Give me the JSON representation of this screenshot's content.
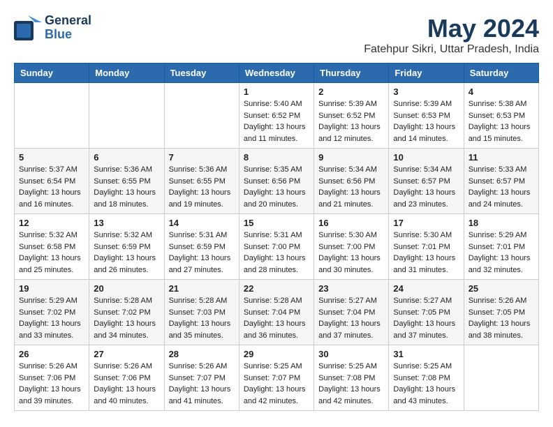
{
  "header": {
    "logo_line1": "General",
    "logo_line2": "Blue",
    "title": "May 2024",
    "subtitle": "Fatehpur Sikri, Uttar Pradesh, India"
  },
  "days_of_week": [
    "Sunday",
    "Monday",
    "Tuesday",
    "Wednesday",
    "Thursday",
    "Friday",
    "Saturday"
  ],
  "weeks": [
    [
      {
        "day": "",
        "sunrise": "",
        "sunset": "",
        "daylight": ""
      },
      {
        "day": "",
        "sunrise": "",
        "sunset": "",
        "daylight": ""
      },
      {
        "day": "",
        "sunrise": "",
        "sunset": "",
        "daylight": ""
      },
      {
        "day": "1",
        "sunrise": "Sunrise: 5:40 AM",
        "sunset": "Sunset: 6:52 PM",
        "daylight": "Daylight: 13 hours and 11 minutes."
      },
      {
        "day": "2",
        "sunrise": "Sunrise: 5:39 AM",
        "sunset": "Sunset: 6:52 PM",
        "daylight": "Daylight: 13 hours and 12 minutes."
      },
      {
        "day": "3",
        "sunrise": "Sunrise: 5:39 AM",
        "sunset": "Sunset: 6:53 PM",
        "daylight": "Daylight: 13 hours and 14 minutes."
      },
      {
        "day": "4",
        "sunrise": "Sunrise: 5:38 AM",
        "sunset": "Sunset: 6:53 PM",
        "daylight": "Daylight: 13 hours and 15 minutes."
      }
    ],
    [
      {
        "day": "5",
        "sunrise": "Sunrise: 5:37 AM",
        "sunset": "Sunset: 6:54 PM",
        "daylight": "Daylight: 13 hours and 16 minutes."
      },
      {
        "day": "6",
        "sunrise": "Sunrise: 5:36 AM",
        "sunset": "Sunset: 6:55 PM",
        "daylight": "Daylight: 13 hours and 18 minutes."
      },
      {
        "day": "7",
        "sunrise": "Sunrise: 5:36 AM",
        "sunset": "Sunset: 6:55 PM",
        "daylight": "Daylight: 13 hours and 19 minutes."
      },
      {
        "day": "8",
        "sunrise": "Sunrise: 5:35 AM",
        "sunset": "Sunset: 6:56 PM",
        "daylight": "Daylight: 13 hours and 20 minutes."
      },
      {
        "day": "9",
        "sunrise": "Sunrise: 5:34 AM",
        "sunset": "Sunset: 6:56 PM",
        "daylight": "Daylight: 13 hours and 21 minutes."
      },
      {
        "day": "10",
        "sunrise": "Sunrise: 5:34 AM",
        "sunset": "Sunset: 6:57 PM",
        "daylight": "Daylight: 13 hours and 23 minutes."
      },
      {
        "day": "11",
        "sunrise": "Sunrise: 5:33 AM",
        "sunset": "Sunset: 6:57 PM",
        "daylight": "Daylight: 13 hours and 24 minutes."
      }
    ],
    [
      {
        "day": "12",
        "sunrise": "Sunrise: 5:32 AM",
        "sunset": "Sunset: 6:58 PM",
        "daylight": "Daylight: 13 hours and 25 minutes."
      },
      {
        "day": "13",
        "sunrise": "Sunrise: 5:32 AM",
        "sunset": "Sunset: 6:59 PM",
        "daylight": "Daylight: 13 hours and 26 minutes."
      },
      {
        "day": "14",
        "sunrise": "Sunrise: 5:31 AM",
        "sunset": "Sunset: 6:59 PM",
        "daylight": "Daylight: 13 hours and 27 minutes."
      },
      {
        "day": "15",
        "sunrise": "Sunrise: 5:31 AM",
        "sunset": "Sunset: 7:00 PM",
        "daylight": "Daylight: 13 hours and 28 minutes."
      },
      {
        "day": "16",
        "sunrise": "Sunrise: 5:30 AM",
        "sunset": "Sunset: 7:00 PM",
        "daylight": "Daylight: 13 hours and 30 minutes."
      },
      {
        "day": "17",
        "sunrise": "Sunrise: 5:30 AM",
        "sunset": "Sunset: 7:01 PM",
        "daylight": "Daylight: 13 hours and 31 minutes."
      },
      {
        "day": "18",
        "sunrise": "Sunrise: 5:29 AM",
        "sunset": "Sunset: 7:01 PM",
        "daylight": "Daylight: 13 hours and 32 minutes."
      }
    ],
    [
      {
        "day": "19",
        "sunrise": "Sunrise: 5:29 AM",
        "sunset": "Sunset: 7:02 PM",
        "daylight": "Daylight: 13 hours and 33 minutes."
      },
      {
        "day": "20",
        "sunrise": "Sunrise: 5:28 AM",
        "sunset": "Sunset: 7:02 PM",
        "daylight": "Daylight: 13 hours and 34 minutes."
      },
      {
        "day": "21",
        "sunrise": "Sunrise: 5:28 AM",
        "sunset": "Sunset: 7:03 PM",
        "daylight": "Daylight: 13 hours and 35 minutes."
      },
      {
        "day": "22",
        "sunrise": "Sunrise: 5:28 AM",
        "sunset": "Sunset: 7:04 PM",
        "daylight": "Daylight: 13 hours and 36 minutes."
      },
      {
        "day": "23",
        "sunrise": "Sunrise: 5:27 AM",
        "sunset": "Sunset: 7:04 PM",
        "daylight": "Daylight: 13 hours and 37 minutes."
      },
      {
        "day": "24",
        "sunrise": "Sunrise: 5:27 AM",
        "sunset": "Sunset: 7:05 PM",
        "daylight": "Daylight: 13 hours and 37 minutes."
      },
      {
        "day": "25",
        "sunrise": "Sunrise: 5:26 AM",
        "sunset": "Sunset: 7:05 PM",
        "daylight": "Daylight: 13 hours and 38 minutes."
      }
    ],
    [
      {
        "day": "26",
        "sunrise": "Sunrise: 5:26 AM",
        "sunset": "Sunset: 7:06 PM",
        "daylight": "Daylight: 13 hours and 39 minutes."
      },
      {
        "day": "27",
        "sunrise": "Sunrise: 5:26 AM",
        "sunset": "Sunset: 7:06 PM",
        "daylight": "Daylight: 13 hours and 40 minutes."
      },
      {
        "day": "28",
        "sunrise": "Sunrise: 5:26 AM",
        "sunset": "Sunset: 7:07 PM",
        "daylight": "Daylight: 13 hours and 41 minutes."
      },
      {
        "day": "29",
        "sunrise": "Sunrise: 5:25 AM",
        "sunset": "Sunset: 7:07 PM",
        "daylight": "Daylight: 13 hours and 42 minutes."
      },
      {
        "day": "30",
        "sunrise": "Sunrise: 5:25 AM",
        "sunset": "Sunset: 7:08 PM",
        "daylight": "Daylight: 13 hours and 42 minutes."
      },
      {
        "day": "31",
        "sunrise": "Sunrise: 5:25 AM",
        "sunset": "Sunset: 7:08 PM",
        "daylight": "Daylight: 13 hours and 43 minutes."
      },
      {
        "day": "",
        "sunrise": "",
        "sunset": "",
        "daylight": ""
      }
    ]
  ]
}
